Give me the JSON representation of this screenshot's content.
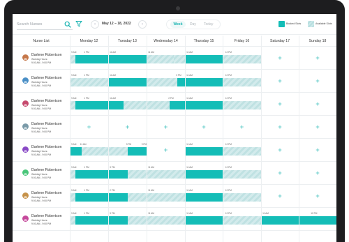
{
  "toolbar": {
    "search_placeholder": "Search Nurses",
    "date_range": "May 12 – 18, 2022",
    "prev": "‹",
    "next": "›",
    "views": [
      "Week",
      "Day",
      "Today"
    ],
    "legend_booked": "Booked Slots",
    "legend_available": "Available Slots",
    "colors": {
      "accent": "#14bdb7",
      "available": "#cce9ea"
    }
  },
  "header": {
    "nurse_list": "Nurse List",
    "days": [
      "Monday 12",
      "Tuesday 13",
      "Wednesday 14",
      "Thursday 15",
      "Friday 16",
      "Saturday 17",
      "Sunday 18"
    ]
  },
  "plus_symbol": "+",
  "nurses": [
    {
      "name": "Darlene Robertson",
      "label": "Working Hours :",
      "hours": "9:00 AM - 9:00 PM",
      "avatar_color": "#c6784a",
      "times": [
        "9 AM",
        "1 PM",
        "11 AM",
        "11 AM",
        "11 AM",
        "12 PM"
      ]
    },
    {
      "name": "Darlene Robertson",
      "label": "Working Hours :",
      "hours": "9:00 AM - 9:00 PM",
      "avatar_color": "#4a8fc6",
      "times": [
        "9 AM",
        "1 PM",
        "11 AM",
        "3 PM",
        "11 AM",
        "12 PM"
      ]
    },
    {
      "name": "Darlene Robertson",
      "label": "Working Hours :",
      "hours": "9:00 AM - 9:00 PM",
      "avatar_color": "#c64a6e",
      "times": [
        "9 AM",
        "1 PM",
        "11 AM",
        "2 PM",
        "11 AM",
        "12 PM"
      ]
    },
    {
      "name": "Darlene Robertson",
      "label": "Working Hours :",
      "hours": "9:00 AM - 9:00 PM",
      "avatar_color": "#7a9aa8",
      "times": []
    },
    {
      "name": "Darlene Robertson",
      "label": "Working Hours :",
      "hours": "9:00 AM - 9:00 PM",
      "avatar_color": "#8a4ac6",
      "times": [
        "9 AM",
        "11 AM",
        "3 PM",
        "9 PM",
        "11 AM",
        "12 PM"
      ]
    },
    {
      "name": "Darlene Robertson",
      "label": "Working Hours :",
      "hours": "9:00 AM - 9:00 PM",
      "avatar_color": "#4ac67a",
      "times": [
        "9 AM",
        "1 PM",
        "3 PM",
        "11 AM",
        "11 AM",
        "12 PM"
      ]
    },
    {
      "name": "Darlene Robertson",
      "label": "Working Hours :",
      "hours": "9:00 AM - 9:00 PM",
      "avatar_color": "#c6924a",
      "times": [
        "9 AM",
        "1 PM",
        "2 PM",
        "11 AM",
        "11 AM",
        "12 PM"
      ]
    },
    {
      "name": "Darlene Robertson",
      "label": "Working Hours :",
      "hours": "9:00 AM - 9:00 PM",
      "avatar_color": "#c64a9c",
      "times": [
        "9 AM",
        "1 PM",
        "3 PM",
        "11 AM",
        "11 AM",
        "12 PM",
        "11 AM",
        "12 PM"
      ]
    }
  ]
}
